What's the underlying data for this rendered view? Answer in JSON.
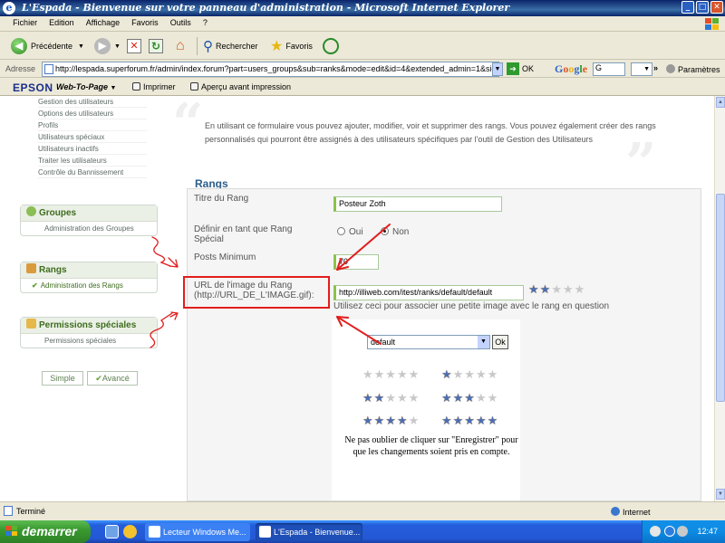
{
  "window": {
    "title": "L'Espada - Bienvenue sur votre panneau d'administration - Microsoft Internet Explorer",
    "min": "_",
    "max": "□",
    "close": "✕"
  },
  "menu": [
    "Fichier",
    "Edition",
    "Affichage",
    "Favoris",
    "Outils",
    "?"
  ],
  "toolbar": {
    "back": "Précédente",
    "search": "Rechercher",
    "favorites": "Favoris"
  },
  "address": {
    "label": "Adresse",
    "url": "http://lespada.superforum.fr/admin/index.forum?part=users_groups&sub=ranks&mode=edit&id=4&extended_admin=1&sid=4",
    "go": "OK",
    "google_input": "G",
    "settings": "Paramètres"
  },
  "epson": {
    "logo": "EPSON",
    "web_to_page": "Web-To-Page",
    "print": "Imprimer",
    "preview": "Aperçu avant impression"
  },
  "sidebar": {
    "user_links": [
      "Gestion des utilisateurs",
      "Options des utilisateurs",
      "Profils",
      "Utilisateurs spéciaux",
      "Utilisateurs inactifs",
      "Traiter les utilisateurs",
      "Contrôle du Bannissement"
    ],
    "groups": {
      "title": "Groupes",
      "items": [
        "Administration des Groupes"
      ]
    },
    "ranks": {
      "title": "Rangs",
      "items": [
        "Administration des Rangs"
      ]
    },
    "permissions": {
      "title": "Permissions spéciales",
      "items": [
        "Permissions spéciales"
      ]
    },
    "simple": "Simple",
    "advanced": "Avancé"
  },
  "main": {
    "intro": "En utilisant ce formulaire vous pouvez ajouter, modifier, voir et supprimer des rangs. Vous pouvez également créer des rangs personnalisés qui pourront être assignés à des utilisateurs spécifiques par l'outil de Gestion des Utilisateurs",
    "section": "Rangs",
    "rank_title_label": "Titre du Rang",
    "rank_title_value": "Posteur Zoth",
    "special_label": "Définir en tant que Rang Spécial",
    "yes": "Oui",
    "no": "Non",
    "special_selected": "Non",
    "min_posts_label": "Posts Minimum",
    "min_posts_value": "70",
    "image_url_label": "URL de l'image du Rang (http://URL_DE_L'IMAGE.gif):",
    "image_url_value": "http://illiweb.com/itest/ranks/default/default",
    "image_hint": "Utilisez ceci pour associer une petite image avec le rang en question",
    "preview_stars": 2,
    "set_select": "default",
    "ok": "Ok",
    "star_sets": [
      0,
      1,
      2,
      3,
      4,
      5
    ],
    "note": "Ne pas oublier de cliquer sur \"Enregistrer\" pour que les changements soient pris en compte."
  },
  "status": {
    "text": "Terminé",
    "zone": "Internet"
  },
  "taskbar": {
    "start": "demarrer",
    "tasks": [
      "Lecteur Windows Me...",
      "L'Espada - Bienvenue..."
    ],
    "clock": "12:47"
  },
  "colors": {
    "accent_green": "#3e6c1e",
    "annotation_red": "#e21d1d",
    "title_blue": "#2b5d8b"
  }
}
